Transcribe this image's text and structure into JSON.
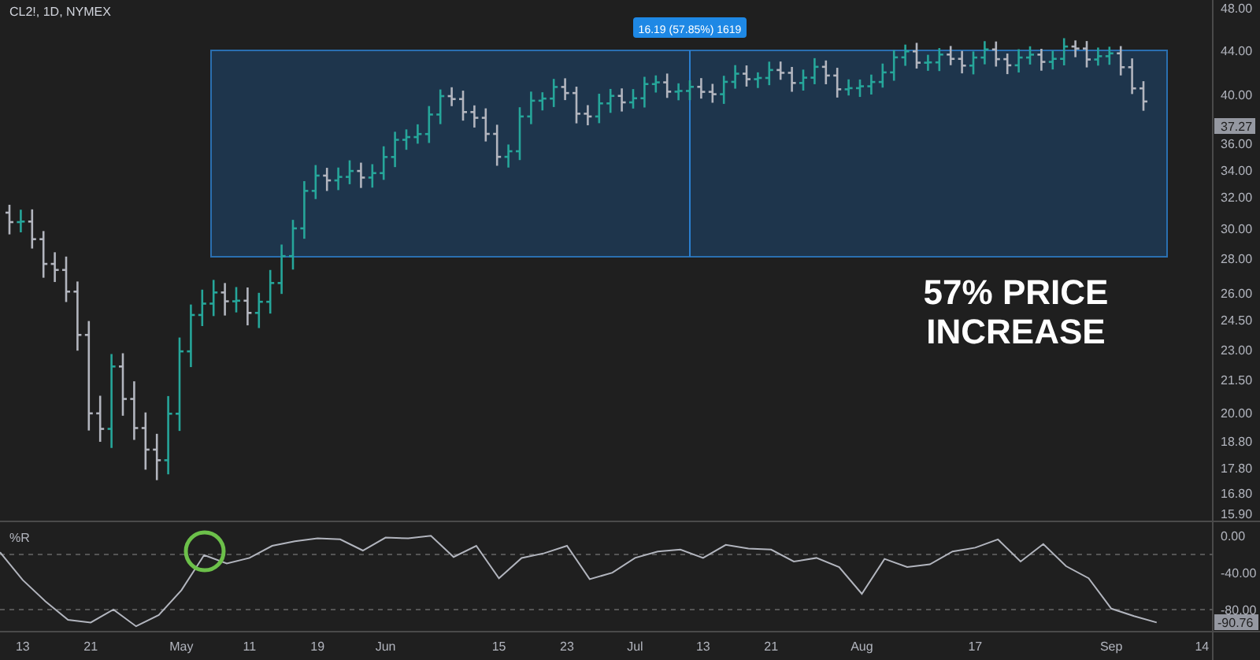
{
  "chart_title": "CL2!, 1D, NYMEX",
  "measure_label": "16.19 (57.85%) 1619",
  "annotation": {
    "lines": [
      "57% PRICE",
      "INCREASE"
    ]
  },
  "price_axis": [
    "48.00",
    "44.00",
    "40.00",
    "36.00",
    "34.00",
    "32.00",
    "30.00",
    "28.00",
    "26.00",
    "24.50",
    "23.00",
    "21.50",
    "20.00",
    "18.80",
    "17.80",
    "16.80",
    "15.90"
  ],
  "current_price": "37.27",
  "indicator": {
    "current_value": "-90.76",
    "chart_data": {
      "type": "line",
      "ylim": [
        -134.5,
        579.6
      ],
      "yticks": [
        {
          "value": 0,
          "label": "0.00"
        },
        {
          "value": -40,
          "label": "-40.00"
        },
        {
          "value": -80,
          "label": "-80.00"
        }
      ],
      "categories": [
        null,
        "13",
        null,
        null,
        "21",
        null,
        null,
        null,
        "May",
        null,
        null,
        "11",
        null,
        null,
        "19",
        null,
        null,
        "Jun",
        null,
        null,
        null,
        null,
        "15",
        null,
        null,
        "23",
        null,
        null,
        "Jul",
        null,
        null,
        "13",
        null,
        null,
        "21",
        null,
        null,
        null,
        "Aug",
        null,
        null,
        null,
        null,
        "17",
        null,
        null,
        null,
        null,
        null,
        "Sep",
        null,
        null,
        null,
        "14"
      ],
      "series": [
        {
          "name": "%R",
          "color": "#b2b5be",
          "values": [
            -18,
            -48,
            -71,
            -91,
            -94,
            -80,
            -98,
            -86,
            -59,
            -21,
            -30,
            -24,
            -11,
            -6,
            -3,
            -4,
            -16,
            -2,
            -3,
            0,
            -23,
            -11,
            -46,
            -24,
            -19,
            -11,
            -47,
            -40,
            -24,
            -17,
            -15,
            -24,
            -10,
            -14,
            -15,
            -28,
            -24,
            -34,
            -63,
            -25,
            -34,
            -31,
            -17,
            -13,
            -4,
            -28,
            -9,
            -33,
            -46,
            -79,
            -87,
            -94,
            null,
            null
          ]
        }
      ]
    }
  }
}
